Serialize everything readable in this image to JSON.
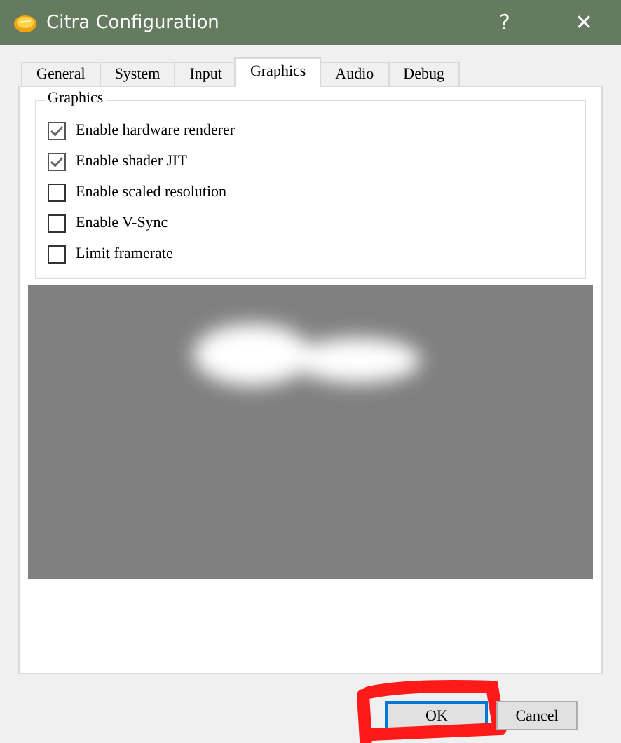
{
  "window": {
    "title": "Citra Configuration",
    "help": "?",
    "close": "✕"
  },
  "tabs": [
    {
      "label": "General",
      "selected": false
    },
    {
      "label": "System",
      "selected": false
    },
    {
      "label": "Input",
      "selected": false
    },
    {
      "label": "Graphics",
      "selected": true
    },
    {
      "label": "Audio",
      "selected": false
    },
    {
      "label": "Debug",
      "selected": false
    }
  ],
  "group": {
    "title": "Graphics",
    "options": [
      {
        "label": "Enable hardware renderer",
        "checked": true
      },
      {
        "label": "Enable shader JIT",
        "checked": true
      },
      {
        "label": "Enable scaled resolution",
        "checked": false
      },
      {
        "label": "Enable V-Sync",
        "checked": false
      },
      {
        "label": "Limit framerate",
        "checked": false
      }
    ]
  },
  "buttons": [
    {
      "label": "OK",
      "default": true
    },
    {
      "label": "Cancel",
      "default": false
    }
  ]
}
